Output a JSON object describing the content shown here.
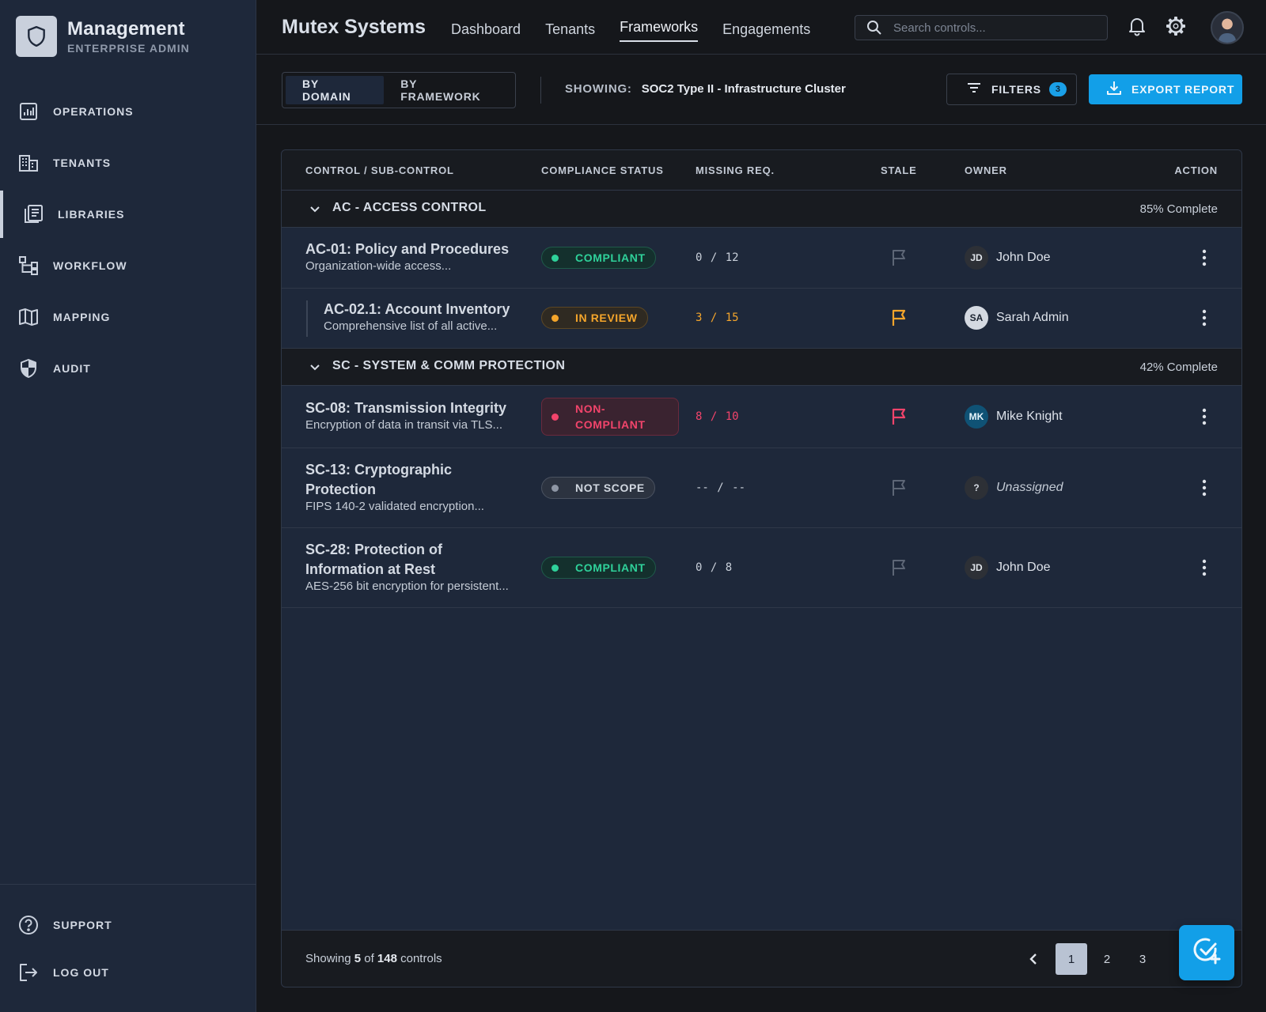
{
  "sidebar": {
    "brand_title": "Management",
    "brand_subtitle": "ENTERPRISE ADMIN",
    "items": [
      {
        "label": "OPERATIONS",
        "icon": "chart-bar-icon"
      },
      {
        "label": "TENANTS",
        "icon": "building-icon"
      },
      {
        "label": "LIBRARIES",
        "icon": "library-icon",
        "active": true
      },
      {
        "label": "WORKFLOW",
        "icon": "workflow-icon"
      },
      {
        "label": "MAPPING",
        "icon": "map-icon"
      },
      {
        "label": "AUDIT",
        "icon": "shield-half-icon"
      }
    ],
    "support_label": "SUPPORT",
    "logout_label": "LOG OUT"
  },
  "header": {
    "title": "Mutex Systems",
    "nav": [
      "Dashboard",
      "Tenants",
      "Frameworks",
      "Engagements"
    ],
    "active_nav": "Frameworks",
    "search_placeholder": "Search controls..."
  },
  "toolbar": {
    "view_by_domain": "BY DOMAIN",
    "view_by_framework": "BY FRAMEWORK",
    "showing_label": "SHOWING:",
    "showing_value": "SOC2 Type II - Infrastructure Cluster",
    "filters_label": "FILTERS",
    "filters_count": "3",
    "export_label": "EXPORT REPORT"
  },
  "table": {
    "columns": [
      "CONTROL / SUB-CONTROL",
      "COMPLIANCE STATUS",
      "MISSING REQ.",
      "STALE",
      "OWNER",
      "ACTION"
    ],
    "groups": [
      {
        "title": "AC - ACCESS CONTROL",
        "progress": "85% Complete",
        "rows": [
          {
            "title": "AC-01: Policy and Procedures",
            "desc": "Organization-wide access...",
            "status": "COMPLIANT",
            "missing": "0 / 12",
            "owner_initials": "JD",
            "owner": "John Doe"
          },
          {
            "title": "AC-02.1: Account Inventory",
            "desc": "Comprehensive list of all active...",
            "status": "IN REVIEW",
            "missing": "3 / 15",
            "owner_initials": "SA",
            "owner": "Sarah Admin"
          }
        ]
      },
      {
        "title": "SC - SYSTEM & COMM PROTECTION",
        "progress": "42% Complete",
        "rows": [
          {
            "title": "SC-08: Transmission Integrity",
            "desc": "Encryption of data in transit via TLS...",
            "status_line1": "NON-",
            "status_line2": "COMPLIANT",
            "missing": "8 / 10",
            "owner_initials": "MK",
            "owner": "Mike Knight"
          },
          {
            "title": "SC-13: Cryptographic Protection",
            "desc": "FIPS 140-2 validated encryption...",
            "status": "NOT SCOPE",
            "missing": "-- / --",
            "owner_initials": "?",
            "owner": "Unassigned"
          },
          {
            "title": "SC-28: Protection of Information at Rest",
            "desc": "AES-256 bit encryption for persistent...",
            "status": "COMPLIANT",
            "missing": "0 / 8",
            "owner_initials": "JD",
            "owner": "John Doe"
          }
        ]
      }
    ],
    "footer": {
      "prefix": "Showing",
      "shown": "5",
      "of": "of",
      "total": "148",
      "suffix": "controls"
    },
    "pages": [
      "1",
      "2",
      "3"
    ]
  },
  "colors": {
    "accent": "#129fe8",
    "compliant": "#2fd19a",
    "review": "#f4a52b",
    "noncompliant": "#f2446b"
  }
}
